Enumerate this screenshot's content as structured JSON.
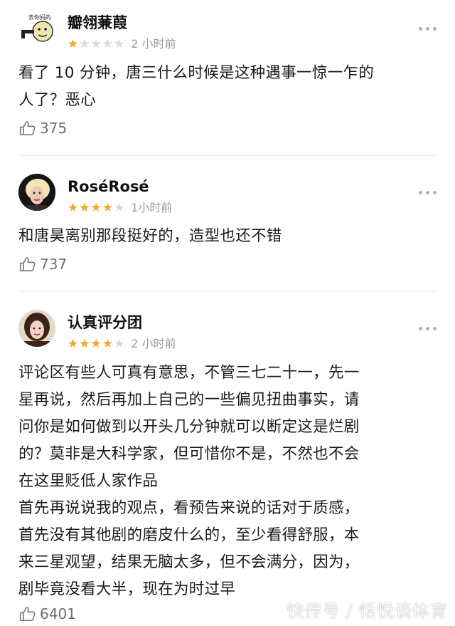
{
  "reviews": [
    {
      "username": "瓣翎蒹葭",
      "avatar_label": "去你妈的",
      "rating": 1,
      "time": "2 小时前",
      "content": [
        "看了 10 分钟，唐三什么时候是这种遇事一惊一乍的",
        "人了？恶心"
      ],
      "likes": "375"
    },
    {
      "username": "RoséRosé",
      "rating": 4,
      "time": "1小时前",
      "content": [
        "和唐昊离别那段挺好的，造型也还不错"
      ],
      "likes": "737"
    },
    {
      "username": "认真评分团",
      "rating": 4,
      "time": "2 小时前",
      "content": [
        "评论区有些人可真有意思，不管三七二十一，先一",
        "星再说，然后再加上自己的一些偏见扭曲事实，请",
        "问你是如何做到以开头几分钟就可以断定这是烂剧",
        "的？莫非是大科学家，但可惜你不是，不然也不会",
        "在这里贬低人家作品",
        "首先再说说我的观点，看预告来说的话对于质感，",
        "首先没有其他剧的磨皮什么的，至少看得舒服，本",
        "来三星观望，结果无脑太多，但不会满分，因为，",
        "剧毕竟没看大半，现在为时过早"
      ],
      "likes": "6401"
    }
  ],
  "watermark": "快传号 / 恬悦谈体育",
  "colors": {
    "star_on": "#f5a623",
    "star_off": "#d8d8d8",
    "time_text": "#9a9a9a",
    "like_text": "#6f6f6f",
    "divider": "#e9e9e9"
  },
  "icons": {
    "like": "thumbs-up-icon",
    "more": "more-dots-icon",
    "star": "star-icon"
  }
}
